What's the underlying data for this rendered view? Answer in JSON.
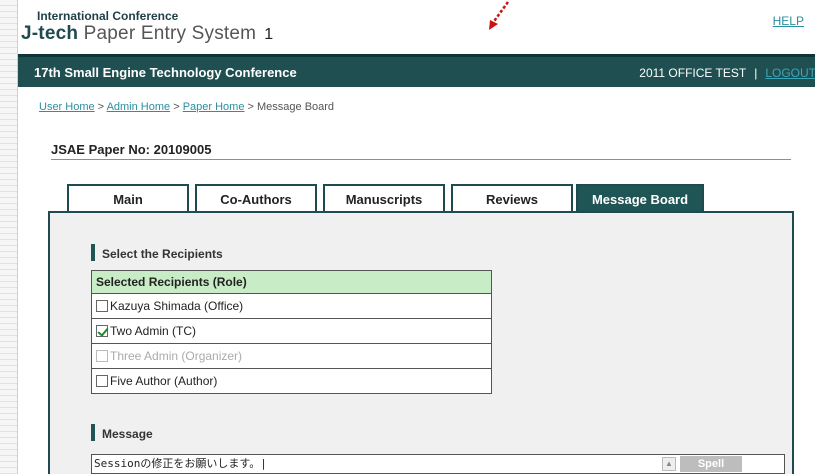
{
  "header": {
    "org_text": "International Conference",
    "logo": {
      "bold": "J-tech",
      "rest": " Paper Entry System",
      "cursor": "1"
    },
    "help_label": "HELP"
  },
  "navbar": {
    "conference_title": "17th Small Engine Technology Conference",
    "user_label": "2011 OFFICE TEST",
    "separator": "|",
    "logout_label": "LOGOUT"
  },
  "breadcrumb": {
    "items": [
      "User Home",
      "Admin Home",
      "Paper Home"
    ],
    "separator": " > ",
    "current": "Message Board"
  },
  "paper": {
    "number_label": "JSAE Paper No: 20109005"
  },
  "tabs": [
    {
      "label": "Main",
      "active": false
    },
    {
      "label": "Co-Authors",
      "active": false
    },
    {
      "label": "Manuscripts",
      "active": false
    },
    {
      "label": "Reviews",
      "active": false
    },
    {
      "label": "Message Board",
      "active": true
    }
  ],
  "recipients": {
    "section_title": "Select the Recipients",
    "column_header": "Selected Recipients (Role)",
    "rows": [
      {
        "label": "Kazuya Shimada (Office)",
        "checked": false,
        "disabled": false
      },
      {
        "label": "Two Admin (TC)",
        "checked": true,
        "disabled": false
      },
      {
        "label": "Three Admin (Organizer)",
        "checked": false,
        "disabled": true
      },
      {
        "label": "Five Author (Author)",
        "checked": false,
        "disabled": false
      }
    ]
  },
  "message": {
    "section_title": "Message",
    "value": "Sessionの修正をお願いします。|",
    "spell_check_label": "Spell Check"
  },
  "colors": {
    "nav_bg": "#1f4f50",
    "accent_link": "#2a8fa0",
    "header_cell": "#c8ecc6"
  }
}
